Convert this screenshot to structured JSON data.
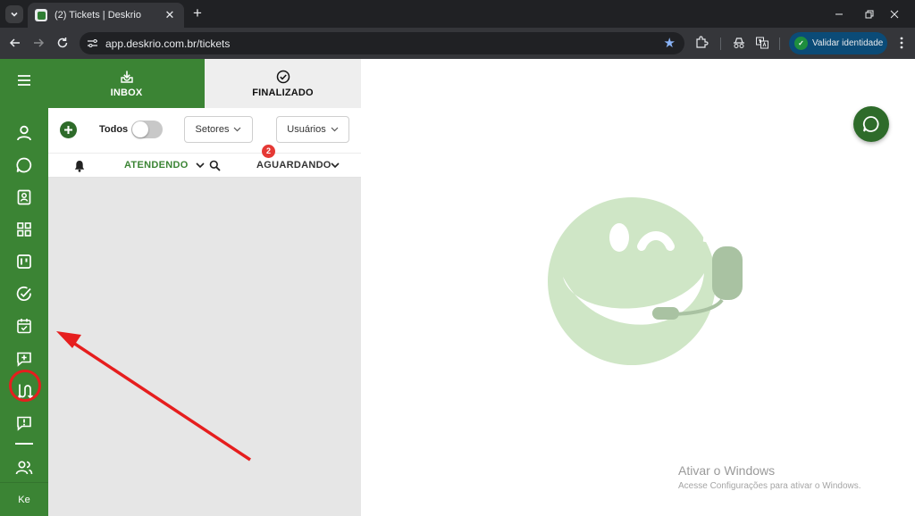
{
  "browser": {
    "tab_title": "(2) Tickets | Deskrio",
    "url": "app.deskrio.com.br/tickets",
    "validate_label": "Validar identidade"
  },
  "app": {
    "tabs": [
      {
        "label": "INBOX",
        "active": true
      },
      {
        "label": "FINALIZADO",
        "active": false
      }
    ],
    "filters": {
      "todos_label": "Todos",
      "todos_on": false,
      "setores_label": "Setores",
      "usuarios_label": "Usuários"
    },
    "status": {
      "atendendo_label": "ATENDENDO",
      "aguardando_label": "AGUARDANDO",
      "aguardando_count": "2"
    },
    "sidebar": {
      "items": [
        "menu-icon",
        "contacts-icon",
        "chat-icon",
        "address-book-icon",
        "dashboard-icon",
        "kanban-icon",
        "check-circle-icon",
        "calendar-check-icon",
        "add-message-icon",
        "route-icon",
        "alert-message-icon",
        "users-icon"
      ],
      "highlighted": "calendar-check-icon",
      "user_initials": "Ke"
    }
  },
  "windows_watermark": {
    "title": "Ativar o Windows",
    "subtitle": "Acesse Configurações para ativar o Windows."
  },
  "colors": {
    "brand_green": "#3b8434",
    "dark_green": "#2e6b2a",
    "badge_red": "#e53935",
    "annotation_red": "#e61e1e"
  }
}
